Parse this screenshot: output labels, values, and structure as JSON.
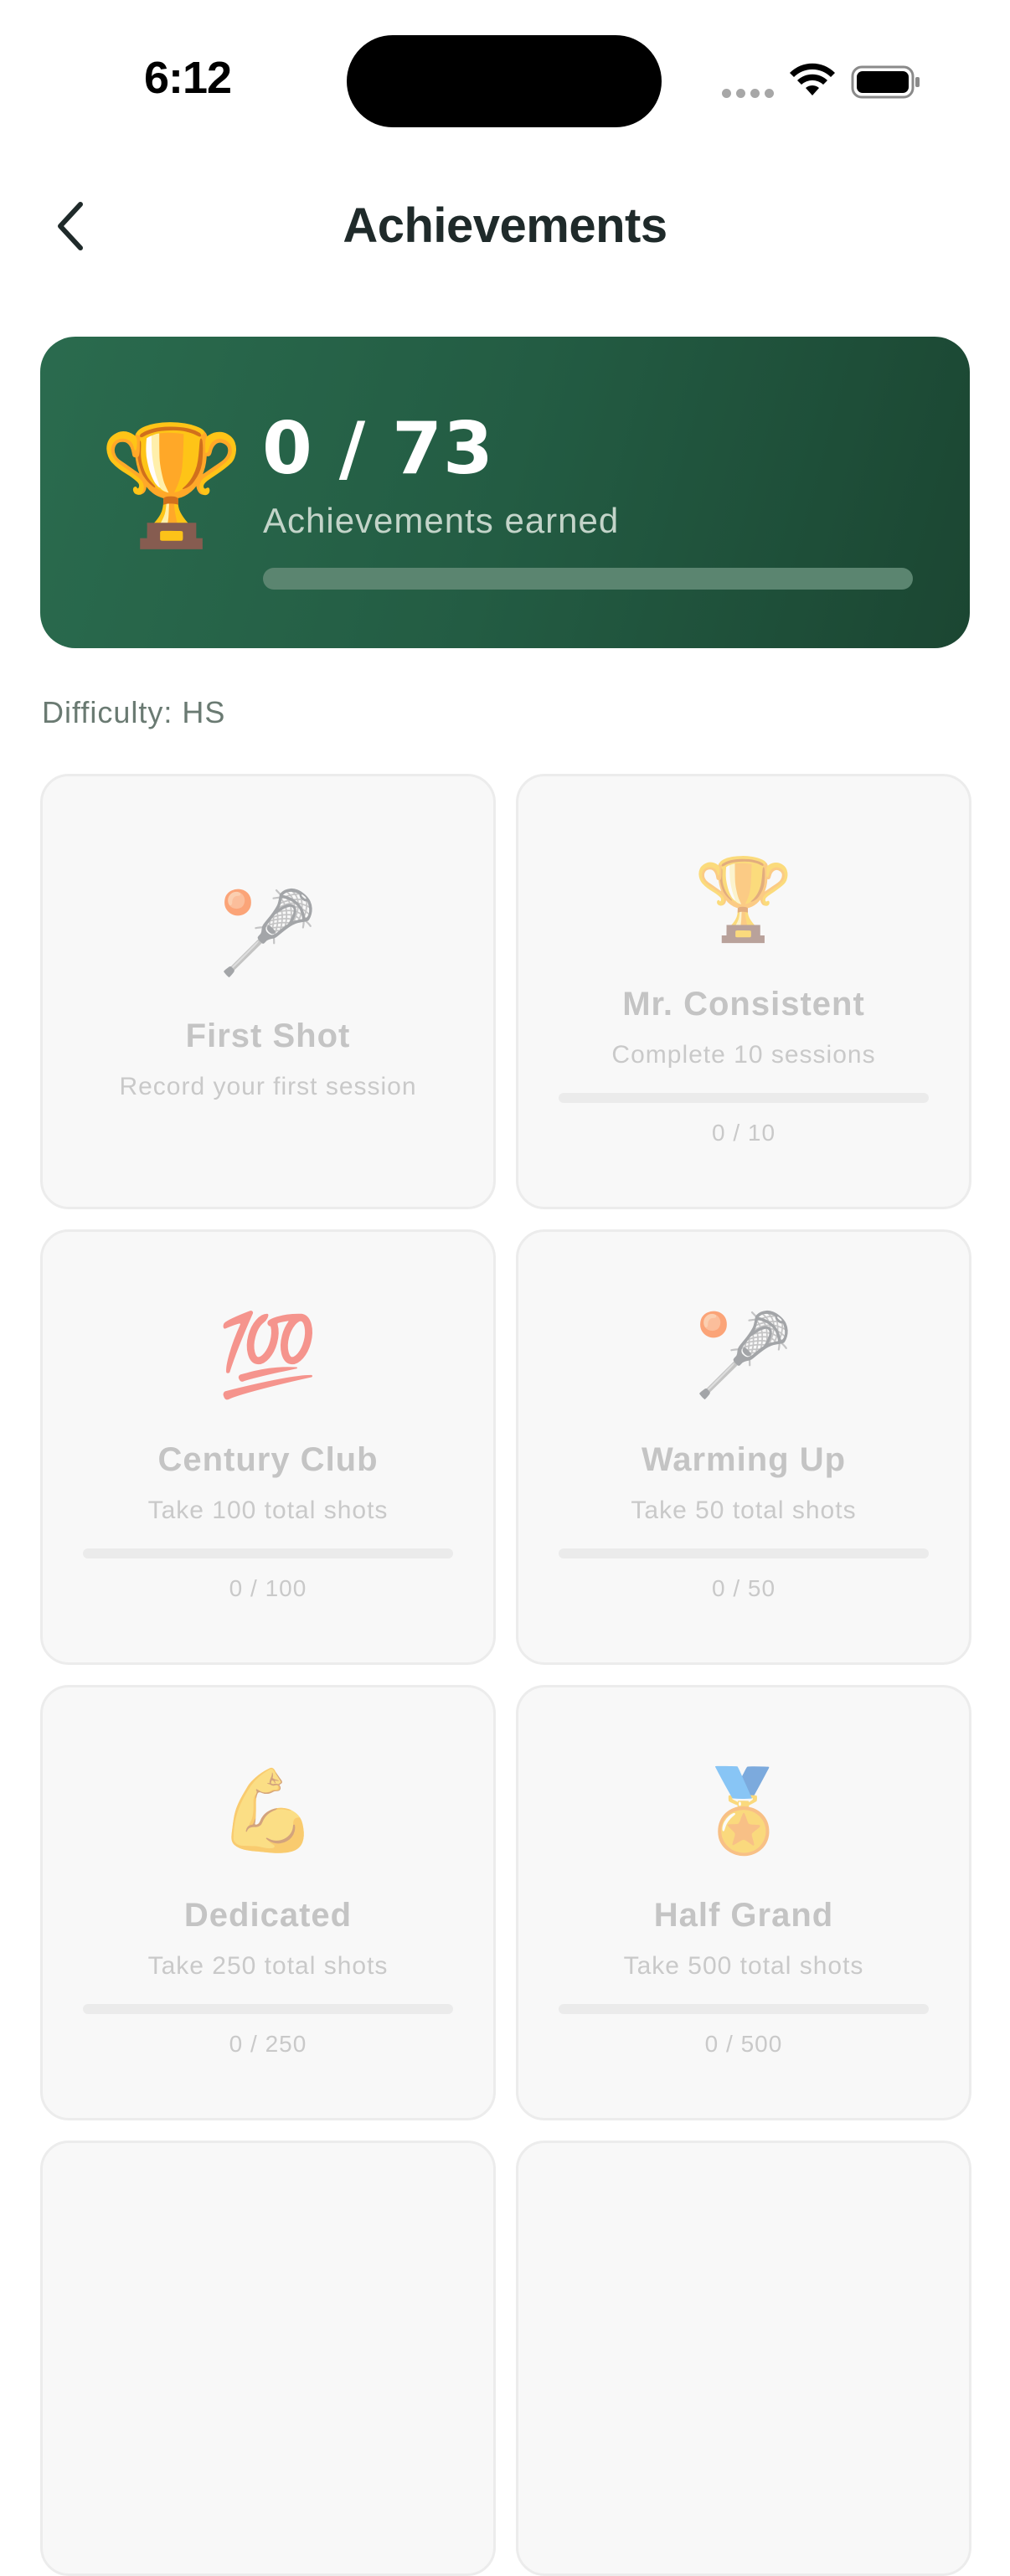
{
  "status": {
    "time": "6:12"
  },
  "nav": {
    "title": "Achievements"
  },
  "hero": {
    "count": "0 / 73",
    "label": "Achievements earned",
    "icon": "trophy-icon",
    "progress": 0
  },
  "difficulty": "Difficulty: HS",
  "colors": {
    "hero_bg": "#235c43",
    "card_bg": "#f8f8f8",
    "locked_text": "#c4c4c4"
  },
  "achievements": [
    {
      "emoji": "🥍",
      "icon": "lacrosse-stick-icon",
      "title": "First Shot",
      "desc": "Record your first session",
      "progress_text": "",
      "progress": null
    },
    {
      "emoji": "🏆",
      "icon": "trophy-icon",
      "title": "Mr. Consistent",
      "desc": "Complete 10 sessions",
      "progress_text": "0 / 10",
      "progress": 0
    },
    {
      "emoji": "💯",
      "icon": "hundred-points-icon",
      "title": "Century Club",
      "desc": "Take 100 total shots",
      "progress_text": "0 / 100",
      "progress": 0
    },
    {
      "emoji": "🥍",
      "icon": "lacrosse-stick-icon",
      "title": "Warming Up",
      "desc": "Take 50 total shots",
      "progress_text": "0 / 50",
      "progress": 0
    },
    {
      "emoji": "💪",
      "icon": "flexed-biceps-icon",
      "title": "Dedicated",
      "desc": "Take 250 total shots",
      "progress_text": "0 / 250",
      "progress": 0
    },
    {
      "emoji": "🏅",
      "icon": "medal-icon",
      "title": "Half Grand",
      "desc": "Take 500 total shots",
      "progress_text": "0 / 500",
      "progress": 0
    },
    {
      "emoji": "",
      "icon": "",
      "title": "",
      "desc": "",
      "progress_text": "",
      "progress": null
    },
    {
      "emoji": "",
      "icon": "",
      "title": "",
      "desc": "",
      "progress_text": "",
      "progress": null
    }
  ]
}
